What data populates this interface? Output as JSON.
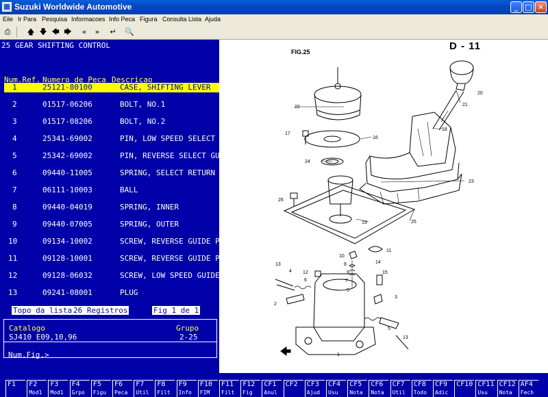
{
  "window": {
    "title": "Suzuki Worldwide Automotive"
  },
  "menu": [
    "Eile",
    "Ir Para",
    "Pesquisa",
    "Informacoes",
    "Info Peca",
    "Figura",
    "Consulta Lista",
    "Ajuda"
  ],
  "toolbar": [
    "printer-icon",
    "up-arrow-icon",
    "down-arrow-icon",
    "left-arrow-icon",
    "right-arrow-icon",
    "double-left-icon",
    "double-right-icon",
    "enter-icon",
    "magnifier-icon"
  ],
  "section": {
    "title": "25  GEAR SHIFTING CONTROL"
  },
  "table": {
    "headers": {
      "ref": "Num.Ref.",
      "part": "Numero de Peca",
      "desc": "Descricao"
    },
    "rows": [
      {
        "ref": "1",
        "part": "25121-80100",
        "desc": "CASE, SHIFTING LEVER",
        "selected": true
      },
      {
        "ref": "2",
        "part": "01517-06206",
        "desc": "BOLT, NO.1"
      },
      {
        "ref": "3",
        "part": "01517-08206",
        "desc": "BOLT, NO.2"
      },
      {
        "ref": "4",
        "part": "25341-69002",
        "desc": "PIN, LOW SPEED SELECT GU"
      },
      {
        "ref": "5",
        "part": "25342-69002",
        "desc": "PIN, REVERSE SELECT GUID"
      },
      {
        "ref": "6",
        "part": "09440-11005",
        "desc": "SPRING, SELECT RETURN"
      },
      {
        "ref": "7",
        "part": "06111-10003",
        "desc": "BALL"
      },
      {
        "ref": "8",
        "part": "09440-04019",
        "desc": "SPRING, INNER"
      },
      {
        "ref": "9",
        "part": "09440-07005",
        "desc": "SPRING, OUTER"
      },
      {
        "ref": "10",
        "part": "09134-10002",
        "desc": "SCREW, REVERSE GUIDE PIN"
      },
      {
        "ref": "11",
        "part": "09128-10001",
        "desc": "SCREW, REVERSE GUIDE PIN"
      },
      {
        "ref": "12",
        "part": "09128-06032",
        "desc": "SCREW, LOW SPEED GUIDE P"
      },
      {
        "ref": "13",
        "part": "09241-08001",
        "desc": "PLUG"
      }
    ]
  },
  "status": {
    "top": "Topo da lista",
    "count": "26 Registros",
    "fig": " Fig 1 de 1 "
  },
  "catalog": {
    "cat_label": "Catalogo",
    "group_label": "Grupo",
    "cat_value": "SJ410 E09,10,96",
    "group_value": "2-25",
    "numfig": "Num.Fig.>"
  },
  "figure": {
    "title": "FIG.25",
    "page": "D - 11",
    "callouts": [
      "1",
      "2",
      "3",
      "4",
      "5",
      "6",
      "7",
      "8",
      "9",
      "10",
      "11",
      "12",
      "13",
      "14",
      "15",
      "16",
      "17",
      "18",
      "19",
      "20",
      "21",
      "22",
      "23",
      "24",
      "25",
      "26"
    ]
  },
  "fkeys": [
    {
      "k": "F1",
      "s": ""
    },
    {
      "k": "F2",
      "s": "Mod1"
    },
    {
      "k": "F3",
      "s": "Mod1"
    },
    {
      "k": "F4",
      "s": "Grpo"
    },
    {
      "k": "F5",
      "s": "Figu"
    },
    {
      "k": "F6",
      "s": "Peca"
    },
    {
      "k": "F7",
      "s": "Util"
    },
    {
      "k": "F8",
      "s": "Filt"
    },
    {
      "k": "F9",
      "s": "Info"
    },
    {
      "k": "F10",
      "s": "FIM"
    },
    {
      "k": "F11",
      "s": "Filt"
    },
    {
      "k": "F12",
      "s": "Fig"
    },
    {
      "k": "CF1",
      "s": "Anul"
    },
    {
      "k": "CF2",
      "s": ""
    },
    {
      "k": "CF3",
      "s": "Ajud"
    },
    {
      "k": "CF4",
      "s": "Usu"
    },
    {
      "k": "CF5",
      "s": "Nota"
    },
    {
      "k": "CF6",
      "s": "Nota"
    },
    {
      "k": "CF7",
      "s": "Util"
    },
    {
      "k": "CF8",
      "s": "Todo"
    },
    {
      "k": "CF9",
      "s": "Adic"
    },
    {
      "k": "CF10",
      "s": ""
    },
    {
      "k": "CF11",
      "s": "Usu"
    },
    {
      "k": "CF12",
      "s": "Nota"
    },
    {
      "k": "AF4",
      "s": "Fech"
    }
  ]
}
